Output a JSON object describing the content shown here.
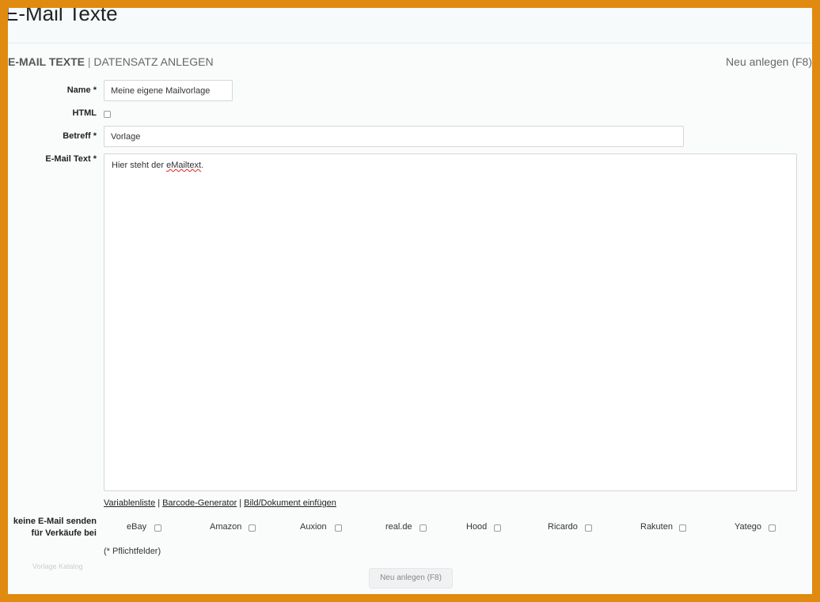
{
  "header": {
    "title": "E-Mail Texte"
  },
  "section": {
    "title_strong": "E-MAIL TEXTE",
    "separator": "|",
    "title_rest": "DATENSATZ ANLEGEN",
    "new_link": "Neu anlegen (F8)"
  },
  "form": {
    "name": {
      "label": "Name *",
      "value": "Meine eigene Mailvorlage"
    },
    "html": {
      "label": "HTML",
      "checked": false
    },
    "subject": {
      "label": "Betreff *",
      "value": "Vorlage"
    },
    "body": {
      "label": "E-Mail Text *",
      "text_before": "Hier steht der ",
      "text_misspelled": "eMailtext",
      "text_after": "."
    },
    "helper_links": {
      "variables": "Variablenliste",
      "barcode": "Barcode-Generator",
      "insert_image": "Bild/Dokument einfügen",
      "separator": "|"
    },
    "suppress": {
      "label_line1": "keine E-Mail senden",
      "label_line2": "für Verkäufe bei",
      "marketplaces": [
        "eBay",
        "Amazon",
        "Auxion",
        "real.de",
        "Hood",
        "Ricardo",
        "Rakuten",
        "Yatego"
      ]
    },
    "required_note": "(* Pflichtfelder)",
    "faded_link": "Vorlage Katalog",
    "submit_label": "Neu anlegen (F8)"
  }
}
